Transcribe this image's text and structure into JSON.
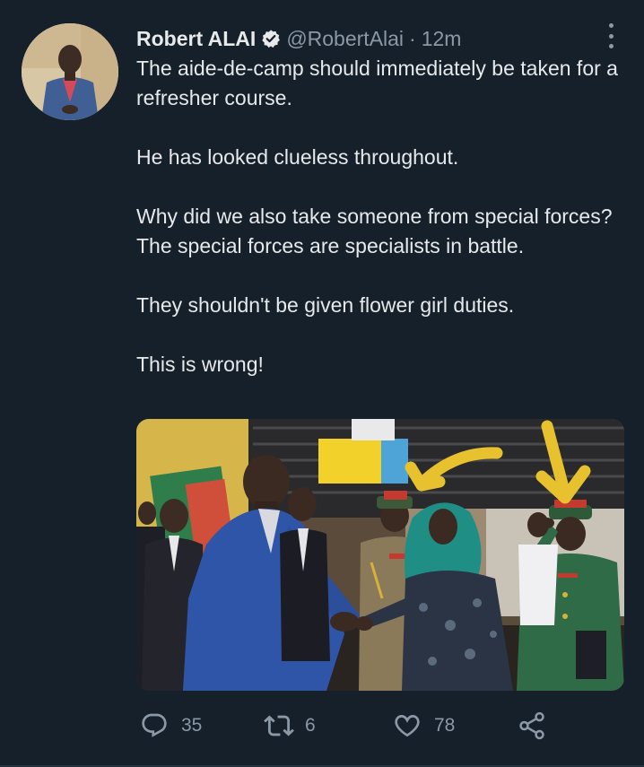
{
  "author": {
    "name": "Robert ALAI",
    "handle": "@RobertAlai",
    "separator": "·",
    "time": "12m"
  },
  "tweet": {
    "paragraphs": [
      "The aide-de-camp should immediately be taken for a refresher course.",
      "He has looked clueless throughout.",
      "Why did we also take someone from special forces? The special forces are specialists in battle.",
      "They shouldn't be given flower girl duties.",
      "This is wrong!"
    ]
  },
  "actions": {
    "replies": "35",
    "retweets": "6",
    "likes": "78"
  },
  "colors": {
    "background": "#15202b",
    "text": "#e7e9ea",
    "muted": "#8b98a5",
    "verified": "#e7e9ea",
    "arrow": "#e8c12e"
  },
  "icons": {
    "verified": "verified-badge-icon",
    "more": "more-options-icon",
    "reply": "reply-icon",
    "retweet": "retweet-icon",
    "like": "heart-icon",
    "share": "share-icon"
  }
}
